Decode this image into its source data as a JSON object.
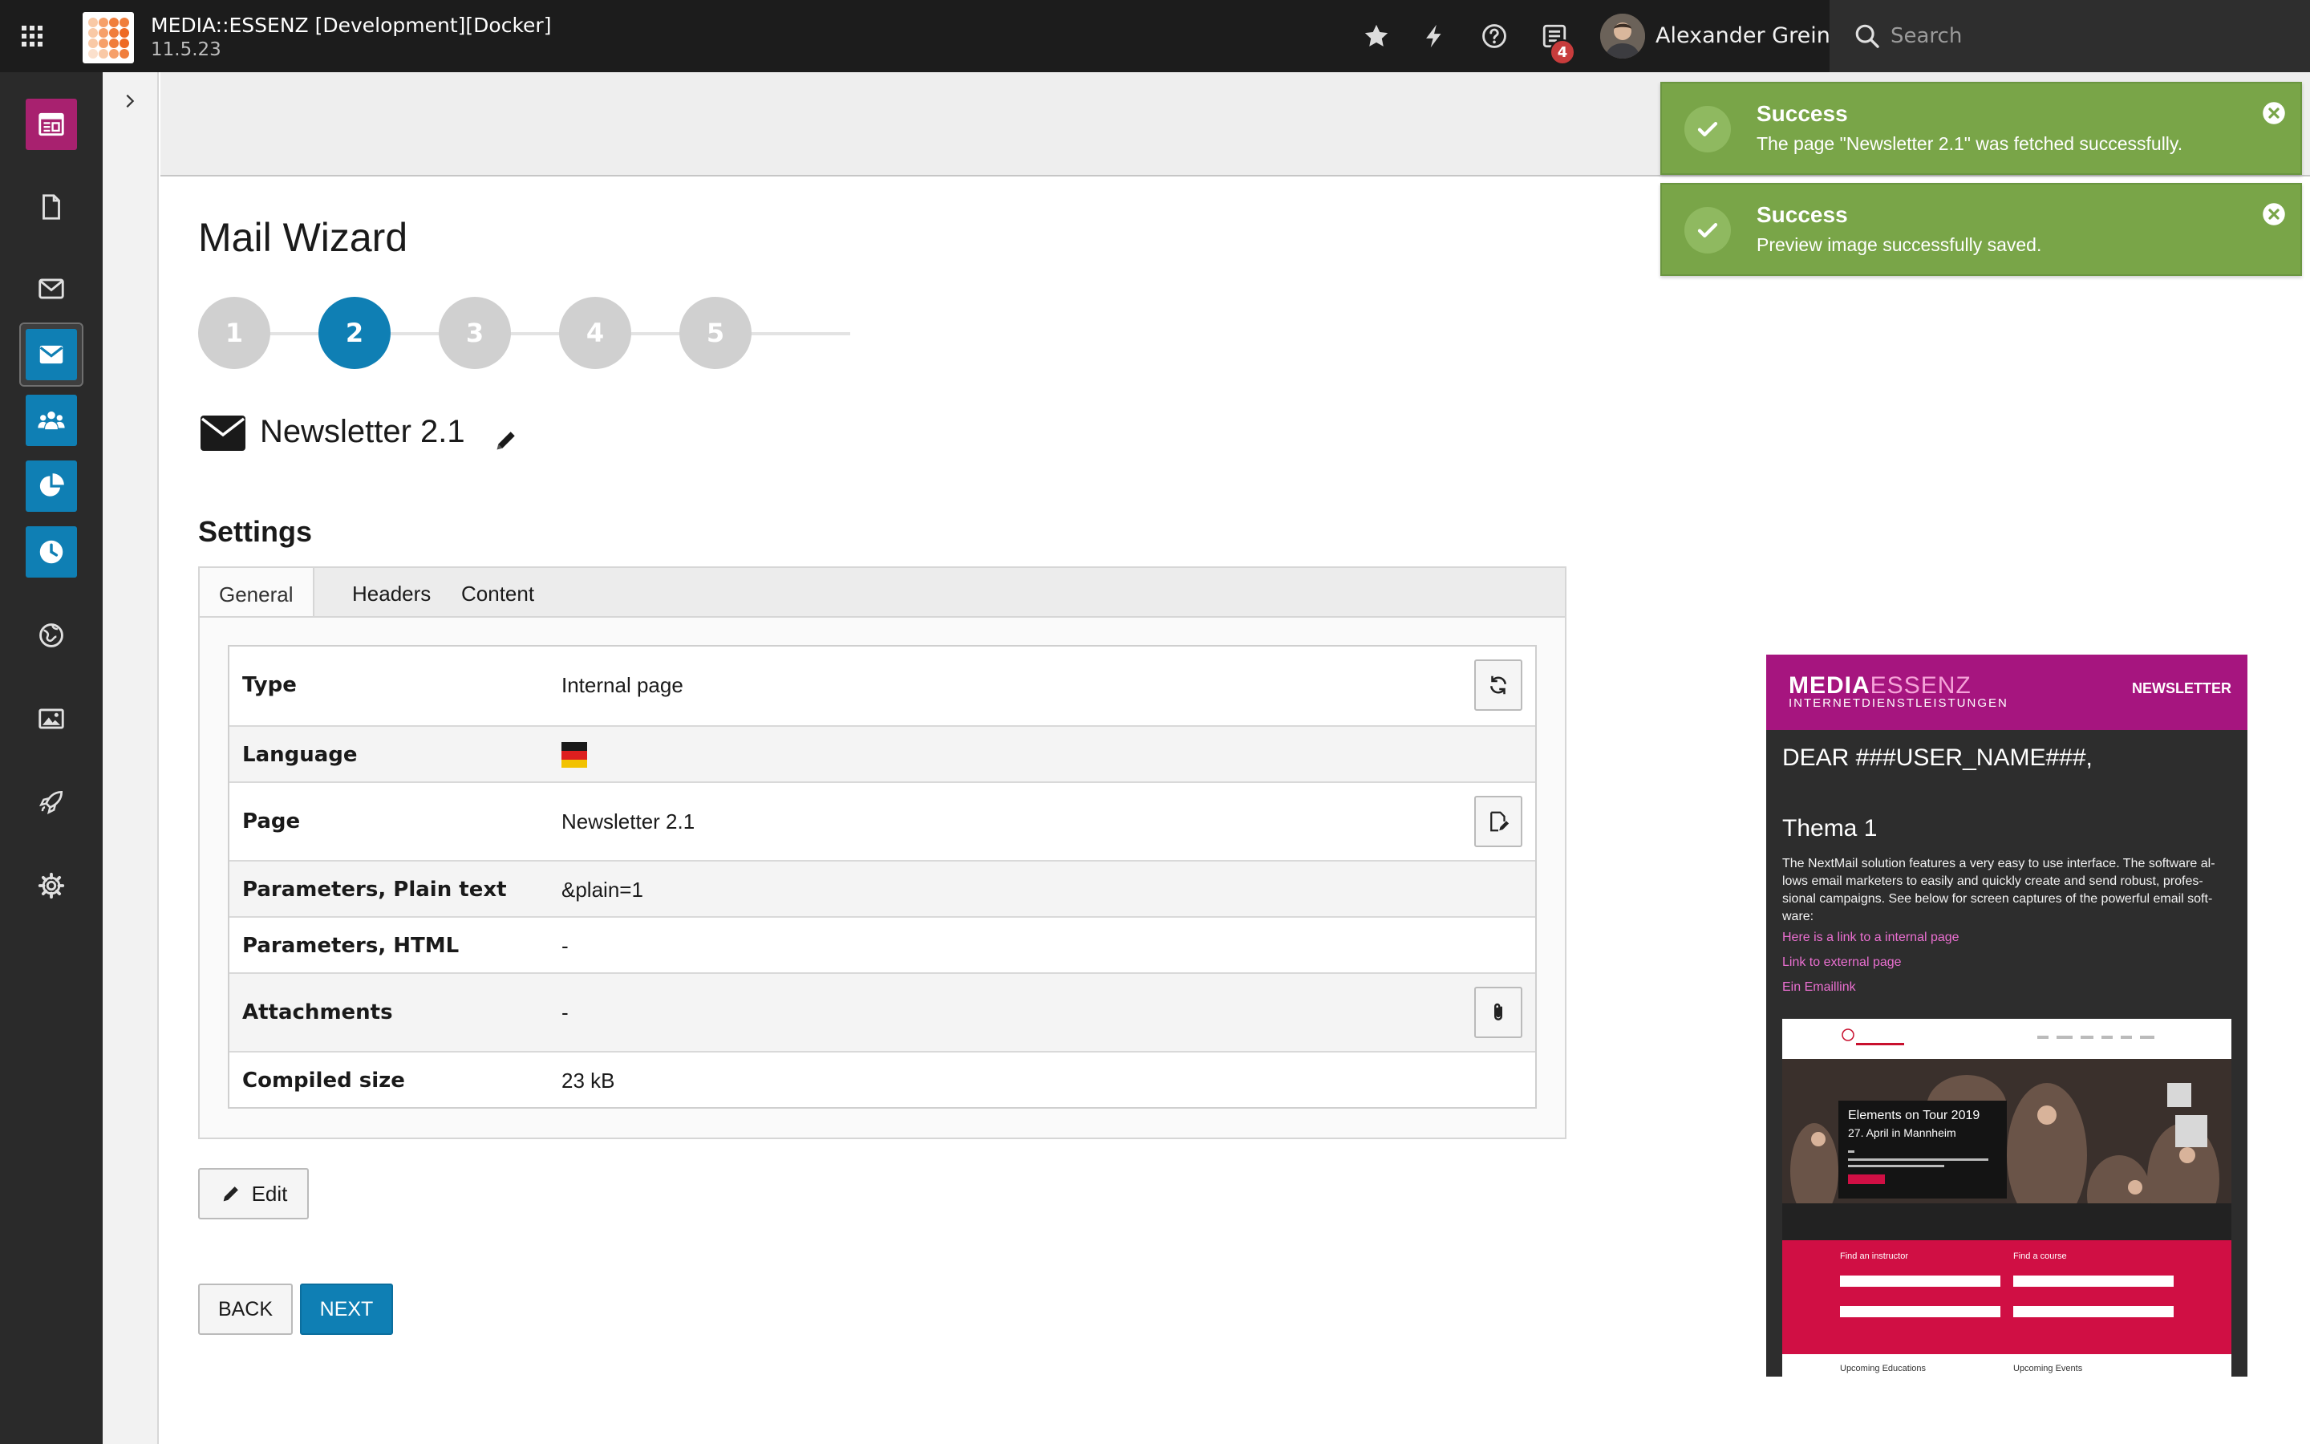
{
  "topbar": {
    "site_name": "MEDIA::ESSENZ [Development][Docker]",
    "version": "11.5.23",
    "notification_count": "4",
    "user_name": "Alexander Grein",
    "search_placeholder": "Search"
  },
  "modules": [
    {
      "icon": "web-page-module-icon",
      "color": "#a8216f"
    },
    {
      "icon": "file-icon",
      "color": "#2a2a2a"
    },
    {
      "icon": "envelope-outline-icon",
      "color": "#2a2a2a"
    },
    {
      "icon": "newsletter-module-icon",
      "color": "#0f7fb4"
    },
    {
      "icon": "recipients-module-icon",
      "color": "#0f7fb4"
    },
    {
      "icon": "statistics-module-icon",
      "color": "#0f7fb4"
    },
    {
      "icon": "queue-clock-module-icon",
      "color": "#0f7fb4"
    },
    {
      "icon": "globe-icon",
      "color": "#2a2a2a"
    },
    {
      "icon": "image-icon",
      "color": "#2a2a2a"
    },
    {
      "icon": "rocket-icon",
      "color": "#2a2a2a"
    },
    {
      "icon": "gear-icon",
      "color": "#2a2a2a"
    }
  ],
  "page": {
    "title": "Mail Wizard",
    "steps": [
      "1",
      "2",
      "3",
      "4",
      "5"
    ],
    "current_step": "2",
    "mail_title": "Newsletter 2.1",
    "settings_title": "Settings",
    "tabs": [
      "General",
      "Headers",
      "Content"
    ],
    "active_tab": "General",
    "rows": [
      {
        "label": "Type",
        "value": "Internal page",
        "action": "refresh-icon"
      },
      {
        "label": "Language",
        "value": "",
        "flag": "german-flag-icon"
      },
      {
        "label": "Page",
        "value": "Newsletter 2.1",
        "action": "edit-page-icon"
      },
      {
        "label": "Parameters, Plain text",
        "value": "&plain=1"
      },
      {
        "label": "Parameters, HTML",
        "value": "-"
      },
      {
        "label": "Attachments",
        "value": "-",
        "action": "paperclip-icon"
      },
      {
        "label": "Compiled size",
        "value": "23 kB"
      }
    ],
    "edit_label": "Edit",
    "back_label": "BACK",
    "next_label": "NEXT"
  },
  "preview": {
    "brand_main": "MEDIA",
    "brand_accent": "ESSENZ",
    "brand_sub": "INTERNETDIENSTLEISTUNGEN",
    "tag": "NEWSLETTER",
    "greeting": "DEAR ###USER_NAME###,",
    "heading": "Thema 1",
    "text": "The NextMail solution features a very easy to use interface. The software al-lows email marketers to easily and quickly create and send robust, profes-sional campaigns. See below for screen captures of the powerful email soft-ware:",
    "links": [
      "Here is a link to a internal page",
      "Link to external page",
      "Ein Emaillink"
    ],
    "hero_title": "Elements on Tour 2019",
    "hero_date": "27. April in Mannheim",
    "find_instructor": "Find an instructor",
    "find_course": "Find a course",
    "upcoming_educations": "Upcoming Educations",
    "upcoming_events": "Upcoming Events"
  },
  "notifications": [
    {
      "title": "Success",
      "message": "The page \"Newsletter 2.1\" was fetched successfully."
    },
    {
      "title": "Success",
      "message": "Preview image successfully saved."
    }
  ]
}
